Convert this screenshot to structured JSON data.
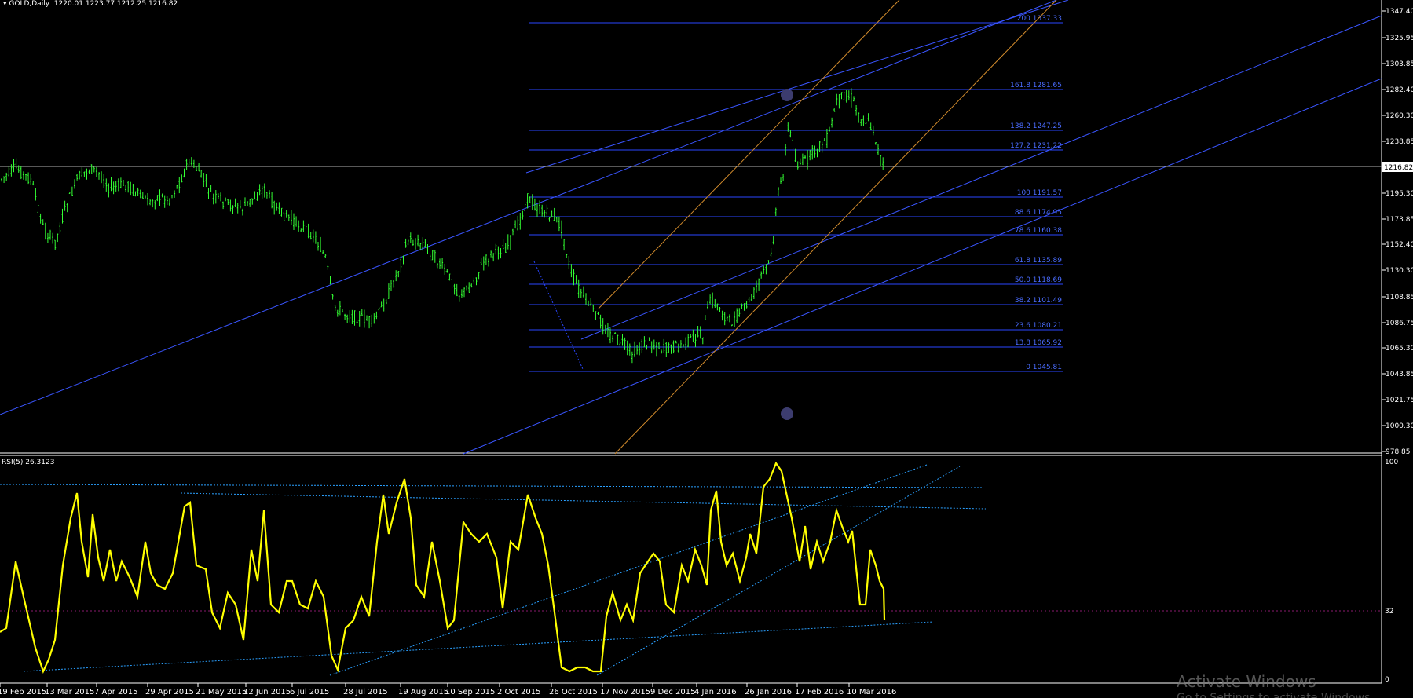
{
  "header": {
    "symbol": "GOLD,Daily",
    "ohlc": "1220.01 1223.77 1212.25 1216.82"
  },
  "rsi_label": "RSI(5) 26.3123",
  "current_price": "1216.82",
  "price_axis": [
    "1347.40",
    "1325.95",
    "1303.85",
    "1282.40",
    "1260.30",
    "1238.85",
    "1216.82",
    "1195.30",
    "1173.85",
    "1152.40",
    "1130.30",
    "1108.85",
    "1086.75",
    "1065.30",
    "1043.85",
    "1021.75",
    "1000.30",
    "978.85"
  ],
  "rsi_axis": [
    "100",
    "32",
    "0"
  ],
  "date_axis": [
    "19 Feb 2015",
    "13 Mar 2015",
    "7 Apr 2015",
    "29 Apr 2015",
    "21 May 2015",
    "12 Jun 2015",
    "6 Jul 2015",
    "28 Jul 2015",
    "19 Aug 2015",
    "10 Sep 2015",
    "2 Oct 2015",
    "26 Oct 2015",
    "17 Nov 2015",
    "9 Dec 2015",
    "4 Jan 2016",
    "26 Jan 2016",
    "17 Feb 2016",
    "10 Mar 2016"
  ],
  "fib_levels": [
    {
      "label": "200 1337.33"
    },
    {
      "label": "161.8 1281.65"
    },
    {
      "label": "138.2 1247.25"
    },
    {
      "label": "127.2 1231.22"
    },
    {
      "label": "100 1191.57"
    },
    {
      "label": "88.6 1174.95"
    },
    {
      "label": "78.6 1160.38"
    },
    {
      "label": "61.8 1135.89"
    },
    {
      "label": "50.0 1118.69"
    },
    {
      "label": "38.2 1101.49"
    },
    {
      "label": "23.6 1080.21"
    },
    {
      "label": "13.8 1065.92"
    },
    {
      "label": "0 1045.81"
    }
  ],
  "watermark": {
    "title": "Activate Windows",
    "subtitle": "Go to Settings to activate Windows."
  },
  "colors": {
    "background": "#000000",
    "candles": "#33ff33",
    "rsi_line": "#ffff00",
    "fib_lines": "#2a46ff",
    "trend_lines": "#3a55ff",
    "channel_lines": "#d08a2c",
    "rsi_trend": "#2aa0ff"
  }
}
